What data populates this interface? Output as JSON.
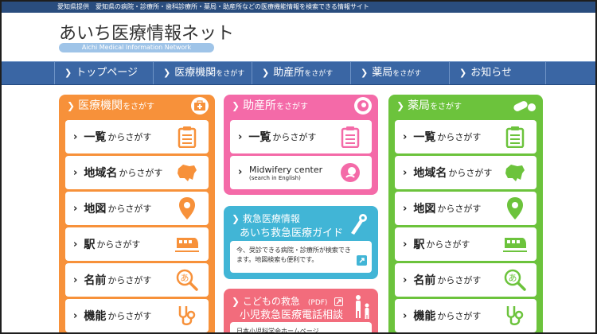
{
  "topbar": {
    "text": "愛知県提供　愛知県の病院・診療所・歯科診療所・薬局・助産所などの医療機能情報を検索できる情報サイト"
  },
  "site": {
    "title": "あいち医療情報ネット",
    "subtitle": "Aichi Medical Information Network"
  },
  "nav": [
    {
      "label": "トップページ",
      "suffix": ""
    },
    {
      "label": "医療機関",
      "suffix": "をさがす"
    },
    {
      "label": "助産所",
      "suffix": "をさがす"
    },
    {
      "label": "薬局",
      "suffix": "をさがす"
    },
    {
      "label": "お知らせ",
      "suffix": ""
    }
  ],
  "hospital": {
    "title": "医療機関",
    "title_suffix": "をさがす",
    "items": [
      {
        "main": "一覧",
        "sub": "からさがす"
      },
      {
        "main": "地域名",
        "sub": "からさがす"
      },
      {
        "main": "地図",
        "sub": "からさがす"
      },
      {
        "main": "駅",
        "sub": "からさがす"
      },
      {
        "main": "名前",
        "sub": "からさがす"
      },
      {
        "main": "機能",
        "sub": "からさがす"
      }
    ]
  },
  "midwife": {
    "title": "助産所",
    "title_suffix": "をさがす",
    "list": {
      "main": "一覧",
      "sub": "からさがす"
    },
    "english": {
      "main": "Midwifery center",
      "sub": "(search in English)"
    }
  },
  "emergency": {
    "line1": "救急医療情報",
    "line2": "あいち救急医療ガイド",
    "body": "今、受診できる病院・診療所が検索できます。地図検索も便利です。"
  },
  "child": {
    "line1": "こどもの救急",
    "pdf": "(PDF)",
    "line2": "小児救急医療電話相談",
    "body": "日本小児科学会ホームページ"
  },
  "pharmacy": {
    "title": "薬局",
    "title_suffix": "をさがす",
    "items": [
      {
        "main": "一覧",
        "sub": "からさがす"
      },
      {
        "main": "地域名",
        "sub": "からさがす"
      },
      {
        "main": "地図",
        "sub": "からさがす"
      },
      {
        "main": "駅",
        "sub": "からさがす"
      },
      {
        "main": "名前",
        "sub": "からさがす"
      },
      {
        "main": "機能",
        "sub": "からさがす"
      }
    ]
  },
  "colors": {
    "hospital": "#f7913a",
    "midwife": "#f46aa8",
    "emergency": "#41b5d6",
    "child": "#f26c7c",
    "pharmacy": "#6cc33c",
    "nav": "#3a66a4"
  },
  "icons": [
    "medical-box-icon",
    "baby-icon",
    "pills-icon",
    "clipboard-icon",
    "dog-map-icon",
    "map-pin-icon",
    "train-icon",
    "magnifier-a-icon",
    "stethoscope-icon",
    "external-link-icon",
    "family-icon",
    "phone-icon"
  ]
}
